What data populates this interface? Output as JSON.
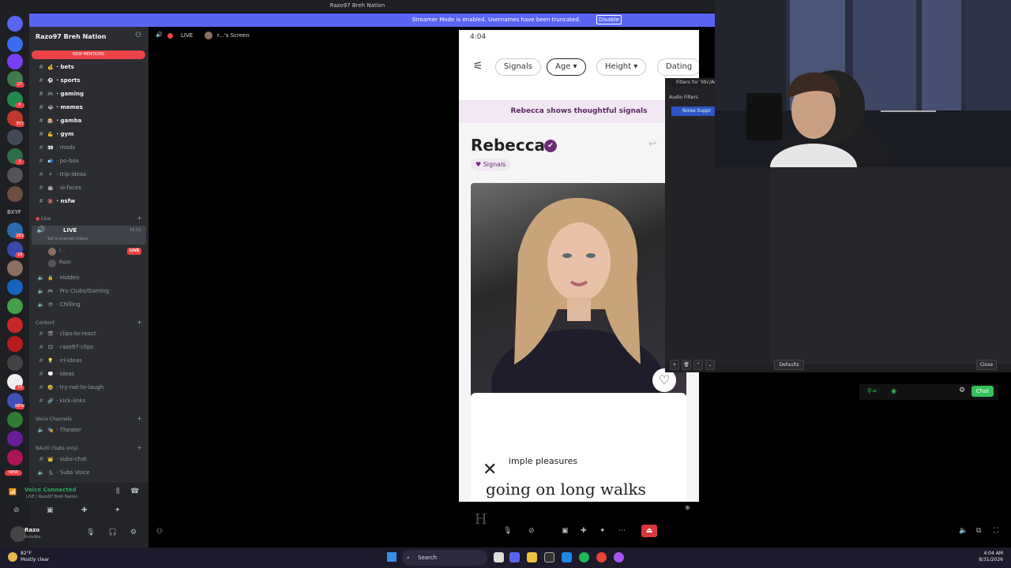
{
  "titlebar": {
    "title": "Razo97 Breh Nation"
  },
  "streamer_banner": {
    "message": "Streamer Mode is enabled. Usernames have been truncated.",
    "button": "Disable"
  },
  "server": {
    "name": "Razo97 Breh Nation",
    "mentions_label": "NEW MENTIONS"
  },
  "server_badges": [
    "27",
    "6",
    "307",
    "3",
    "283",
    "18",
    "15",
    "NEW"
  ],
  "server_text": "BXYF",
  "channels": [
    {
      "label": "bets",
      "unread": true,
      "emoji": "💰"
    },
    {
      "label": "sports",
      "unread": true,
      "emoji": "⚽"
    },
    {
      "label": "gaming",
      "unread": true,
      "emoji": "🎮"
    },
    {
      "label": "memes",
      "unread": true,
      "emoji": "😂"
    },
    {
      "label": "gamba",
      "unread": true,
      "emoji": "🎰"
    },
    {
      "label": "gym",
      "unread": true,
      "emoji": "💪"
    },
    {
      "label": "mods",
      "unread": false,
      "emoji": "👀"
    },
    {
      "label": "po-box",
      "unread": false,
      "emoji": "📬"
    },
    {
      "label": "trip-ideas",
      "unread": false,
      "emoji": "✈"
    },
    {
      "label": "ai-faces",
      "unread": false,
      "emoji": "🤖"
    },
    {
      "label": "nsfw",
      "unread": true,
      "emoji": "🔞"
    }
  ],
  "live_category": "Live",
  "live_channel": {
    "label": "LIVE",
    "time": "15:52",
    "status": "Set a channel status",
    "member1": "r...",
    "member1_badge": "LIVE",
    "member2": "Razo"
  },
  "voice_channels_a": [
    {
      "label": "Hidden",
      "emoji": "🔒"
    },
    {
      "label": "Pro Clubs/Gaming",
      "emoji": "🎮"
    },
    {
      "label": "Chilling",
      "emoji": "😎"
    }
  ],
  "content_category": "Content",
  "content_channels": [
    {
      "label": "clips-to-react",
      "emoji": "🎬"
    },
    {
      "label": "razo97-clips",
      "emoji": "🎞"
    },
    {
      "label": "irl-ideas",
      "emoji": "💡"
    },
    {
      "label": "ideas",
      "emoji": "💭"
    },
    {
      "label": "try-not-to-laugh",
      "emoji": "🤣"
    },
    {
      "label": "kick-links",
      "emoji": "🔗"
    }
  ],
  "voice_category": "Voice Channels",
  "voice_channels_b": [
    {
      "label": "Theater",
      "emoji": "🎭"
    }
  ],
  "subs_category": "BALIG (Subs only)",
  "subs_channels": [
    {
      "label": "subs-chat",
      "emoji": "👑"
    },
    {
      "label": "Subs Voice",
      "emoji": "🎙"
    }
  ],
  "voice_connected": {
    "title": "Voice Connected",
    "subtitle": "LIVE / Razo97 Breh Nation"
  },
  "user": {
    "name": "Razo",
    "status": "Invisible"
  },
  "main_header": {
    "channel": "LIVE",
    "screen": "r...'s Screen"
  },
  "phone": {
    "time": "4:04",
    "filters": [
      "Signals",
      "Age",
      "Height",
      "Dating In"
    ],
    "banner": "Rebecca shows thoughtful signals",
    "name": "Rebecca",
    "signals_chip": "Signals",
    "prompt_question": "imple pleasures",
    "prompt_answer": "going on long walks"
  },
  "obs": {
    "title": "Filters for 'Mic/Au",
    "section": "Audio Filters",
    "filter_item": "Noise Suppr",
    "defaults": "Defaults",
    "close": "Close"
  },
  "chat_button": "Chat",
  "taskbar": {
    "search": "Search",
    "weather_temp": "82°F",
    "weather_desc": "Mostly clear",
    "time": "4:04 AM",
    "date": "8/31/2026"
  }
}
